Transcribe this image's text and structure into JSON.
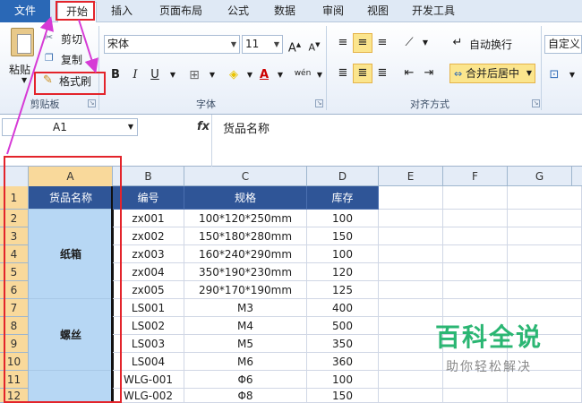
{
  "menu": {
    "tabs": [
      "文件",
      "开始",
      "插入",
      "页面布局",
      "公式",
      "数据",
      "审阅",
      "视图",
      "开发工具"
    ]
  },
  "ribbon": {
    "clipboard": {
      "paste": "粘贴",
      "cut": "剪切",
      "copy": "复制",
      "format_painter": "格式刷",
      "group": "剪贴板"
    },
    "font": {
      "name": "宋体",
      "size": "11",
      "bold": "B",
      "italic": "I",
      "underline": "U",
      "group": "字体",
      "phonetic": "wén"
    },
    "align": {
      "wrap": "自动换行",
      "merge": "合并后居中",
      "group": "对齐方式"
    },
    "number": {
      "format": "自定义"
    }
  },
  "formula_bar": {
    "name_box": "A1",
    "fx": "fx",
    "content": "货品名称"
  },
  "grid": {
    "columns": [
      "A",
      "B",
      "C",
      "D",
      "E",
      "F",
      "G"
    ],
    "rows": [
      "1",
      "2",
      "3",
      "4",
      "5",
      "6",
      "7",
      "8",
      "9",
      "10",
      "11",
      "12"
    ],
    "headers": [
      "货品名称",
      "编号",
      "规格",
      "库存"
    ],
    "groups": [
      "纸箱",
      "螺丝"
    ],
    "data": [
      [
        "zx001",
        "100*120*250mm",
        "100"
      ],
      [
        "zx002",
        "150*180*280mm",
        "150"
      ],
      [
        "zx003",
        "160*240*290mm",
        "100"
      ],
      [
        "zx004",
        "350*190*230mm",
        "120"
      ],
      [
        "zx005",
        "290*170*190mm",
        "125"
      ],
      [
        "LS001",
        "M3",
        "400"
      ],
      [
        "LS002",
        "M4",
        "500"
      ],
      [
        "LS003",
        "M5",
        "350"
      ],
      [
        "LS004",
        "M6",
        "360"
      ],
      [
        "WLG-001",
        "Φ6",
        "100"
      ],
      [
        "WLG-002",
        "Φ8",
        "150"
      ]
    ]
  },
  "watermark": {
    "title": "百科全说",
    "subtitle": "助你轻松解决"
  },
  "colors": {
    "header_fill": "#2f5597",
    "merged_fill": "#b7d7f4",
    "annotation": "#e3242b",
    "file_tab": "#2a68b6"
  }
}
